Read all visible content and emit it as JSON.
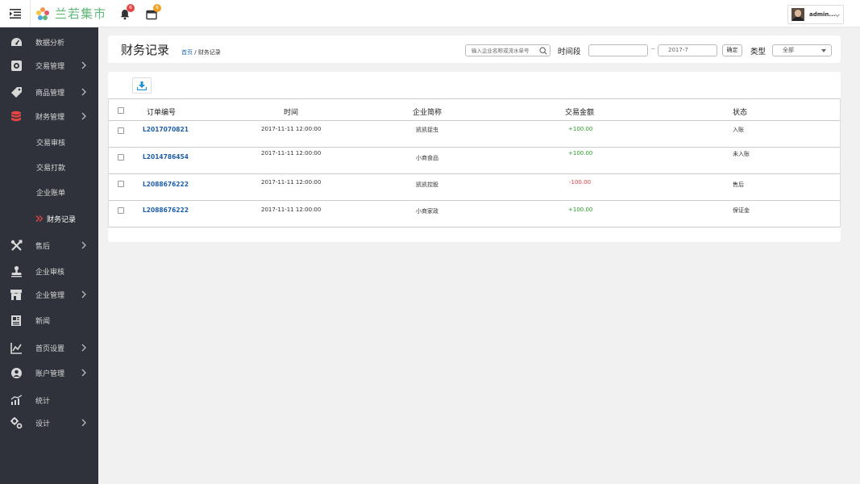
{
  "app": {
    "logo_text": "兰若集市",
    "notifications": [
      {
        "icon": "bell-icon",
        "count": "6",
        "color": "#e64545"
      },
      {
        "icon": "calendar-icon",
        "count": "6",
        "color": "#f0a020"
      }
    ],
    "user": {
      "name": "admin..."
    }
  },
  "sidebar": {
    "items": [
      {
        "label": "数据分析",
        "icon": "dashboard-icon",
        "has_children": false
      },
      {
        "label": "交易管理",
        "icon": "transaction-icon",
        "has_children": true
      },
      {
        "label": "商品管理",
        "icon": "tag-icon",
        "has_children": true
      },
      {
        "label": "财务管理",
        "icon": "database-icon",
        "has_children": true,
        "color": "#e64545"
      },
      {
        "label": "售后",
        "icon": "tools-icon",
        "has_children": true
      },
      {
        "label": "企业审核",
        "icon": "stamp-icon",
        "has_children": false
      },
      {
        "label": "企业管理",
        "icon": "store-icon",
        "has_children": true
      },
      {
        "label": "新闻",
        "icon": "news-icon",
        "has_children": false
      },
      {
        "label": "首页设置",
        "icon": "chart-settings-icon",
        "has_children": true
      },
      {
        "label": "账户管理",
        "icon": "user-circle-icon",
        "has_children": true
      },
      {
        "label": "统计",
        "icon": "stats-icon",
        "has_children": false
      },
      {
        "label": "设计",
        "icon": "gears-icon",
        "has_children": true
      }
    ],
    "finance_children": [
      {
        "label": "交易审核"
      },
      {
        "label": "交易打款"
      },
      {
        "label": "企业账单"
      },
      {
        "label": "财务记录",
        "active": true
      }
    ]
  },
  "header": {
    "title": "财务记录",
    "breadcrumb_home": "首页",
    "breadcrumb_sep": " / ",
    "breadcrumb_current": "财务记录",
    "search_placeholder": "输入企业名称或流水单号",
    "time_label": "时间段",
    "date_from": "",
    "date_to": "2017-7",
    "date_sep": "~",
    "confirm_label": "确定",
    "type_label": "类型",
    "type_value": "全部"
  },
  "table": {
    "columns": [
      "订单编号",
      "时间",
      "企业简称",
      "交易金额",
      "状态"
    ],
    "rows": [
      {
        "order": "L2017070821",
        "time": "2017-11-11 12:00:00",
        "company": "凯凯捉虫",
        "amount": "+100.00",
        "positive": true,
        "status": "入账"
      },
      {
        "order": "L2014786454",
        "time": "2017-11-11 12:00:00",
        "company": "小商食品",
        "amount": "+100.00",
        "positive": true,
        "status": "未入账"
      },
      {
        "order": "L2088676222",
        "time": "2017-11-11 12:00:00",
        "company": "凯凯控股",
        "amount": "-100.00",
        "positive": false,
        "status": "售后"
      },
      {
        "order": "L2088676222",
        "time": "2017-11-11 12:00:00",
        "company": "小商家政",
        "amount": "+100.00",
        "positive": true,
        "status": "保证金"
      }
    ]
  },
  "colors": {
    "sidebar_bg": "#2f323a",
    "brand_green": "#5fb878",
    "link_blue": "#1e5fa8",
    "positive": "#2a9a2a",
    "negative": "#e03a3a",
    "download_blue": "#1e90d8"
  }
}
